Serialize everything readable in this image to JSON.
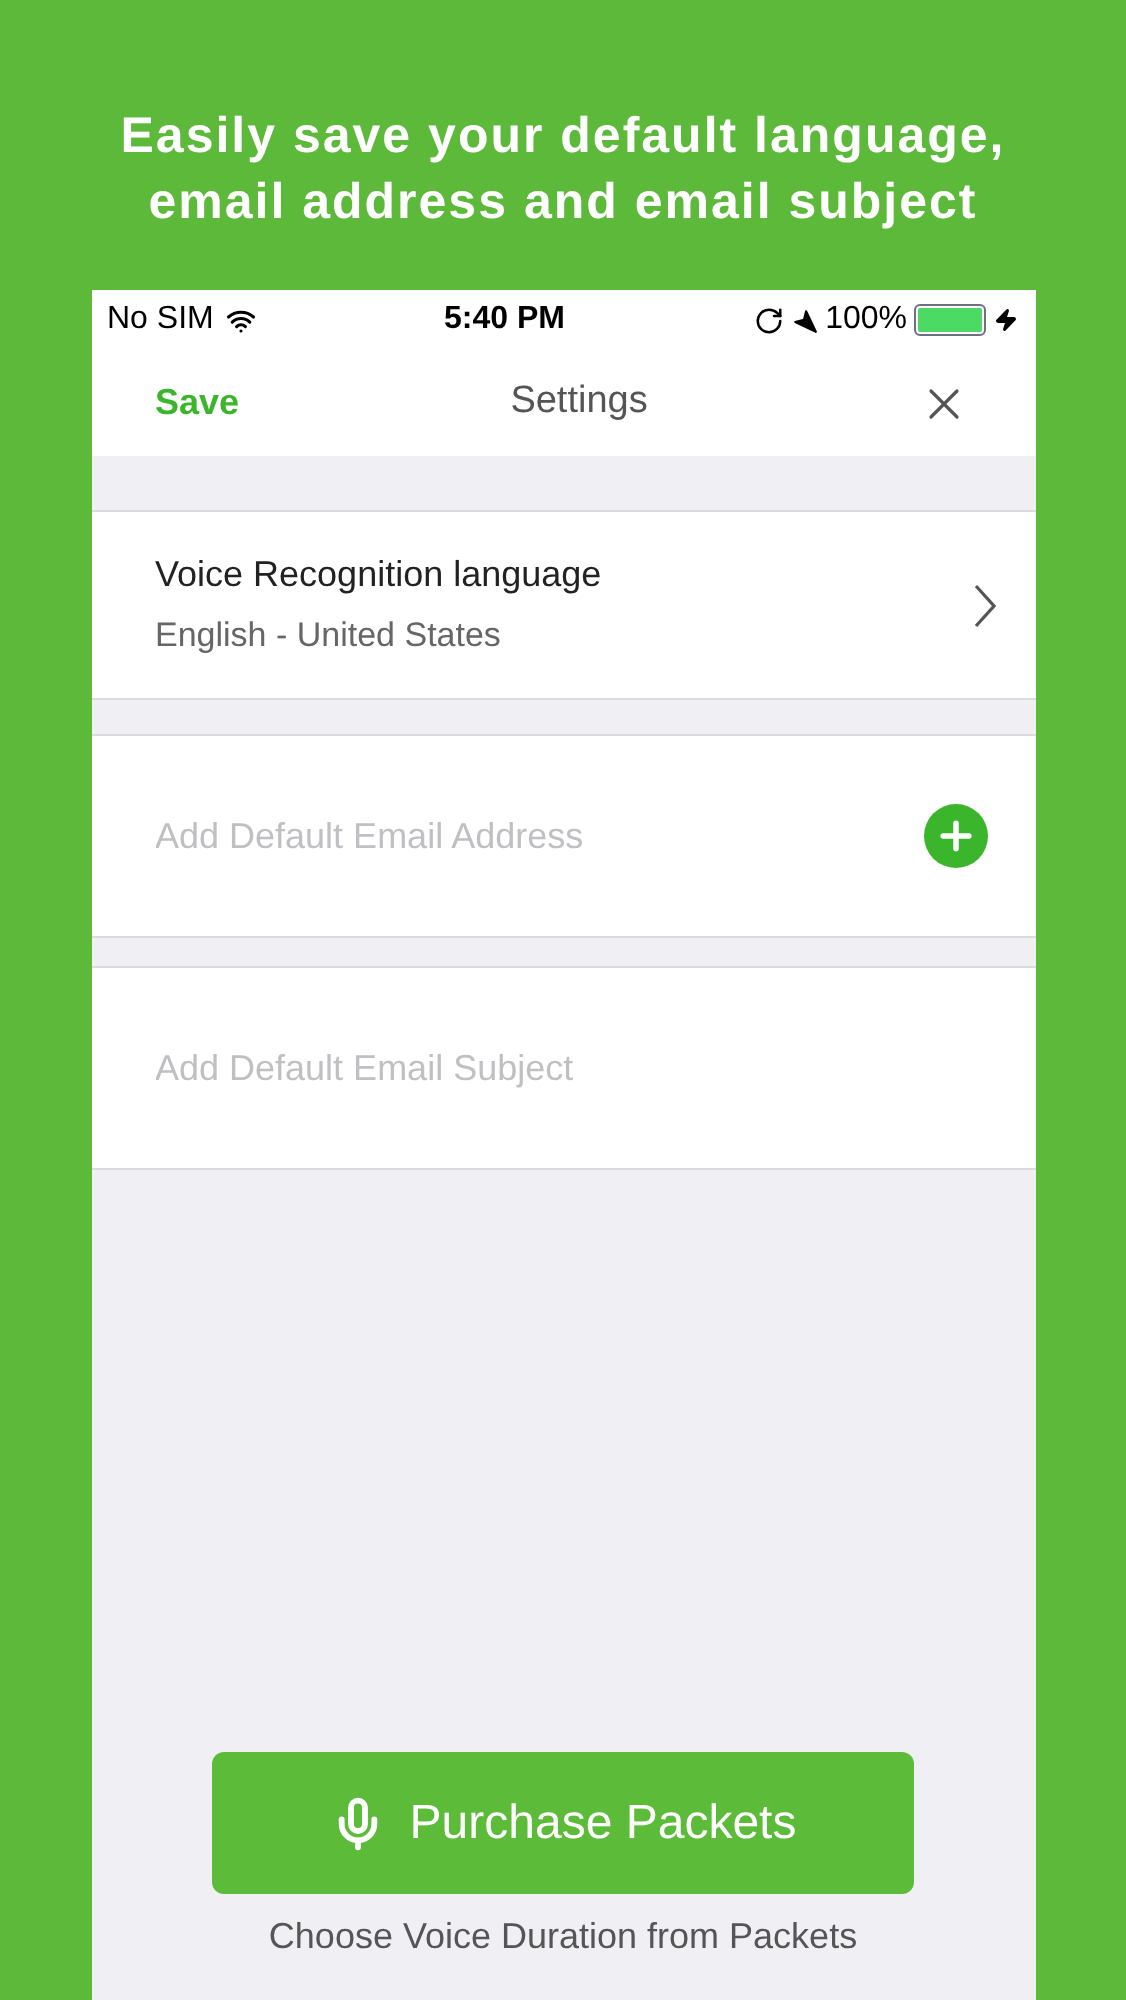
{
  "headline": "Easily save your default language,\nemail address and email subject",
  "status_bar": {
    "carrier": "No SIM",
    "time": "5:40 PM",
    "battery_text": "100%",
    "battery": {
      "level": 1,
      "charging": true
    }
  },
  "nav": {
    "save": "Save",
    "title": "Settings"
  },
  "language": {
    "title": "Voice Recognition language",
    "value": "English - United States"
  },
  "email_field": {
    "placeholder": "Add Default Email Address"
  },
  "subject_field": {
    "placeholder": "Add Default Email Subject"
  },
  "purchase_button": "Purchase Packets",
  "caption": "Choose Voice Duration from Packets"
}
